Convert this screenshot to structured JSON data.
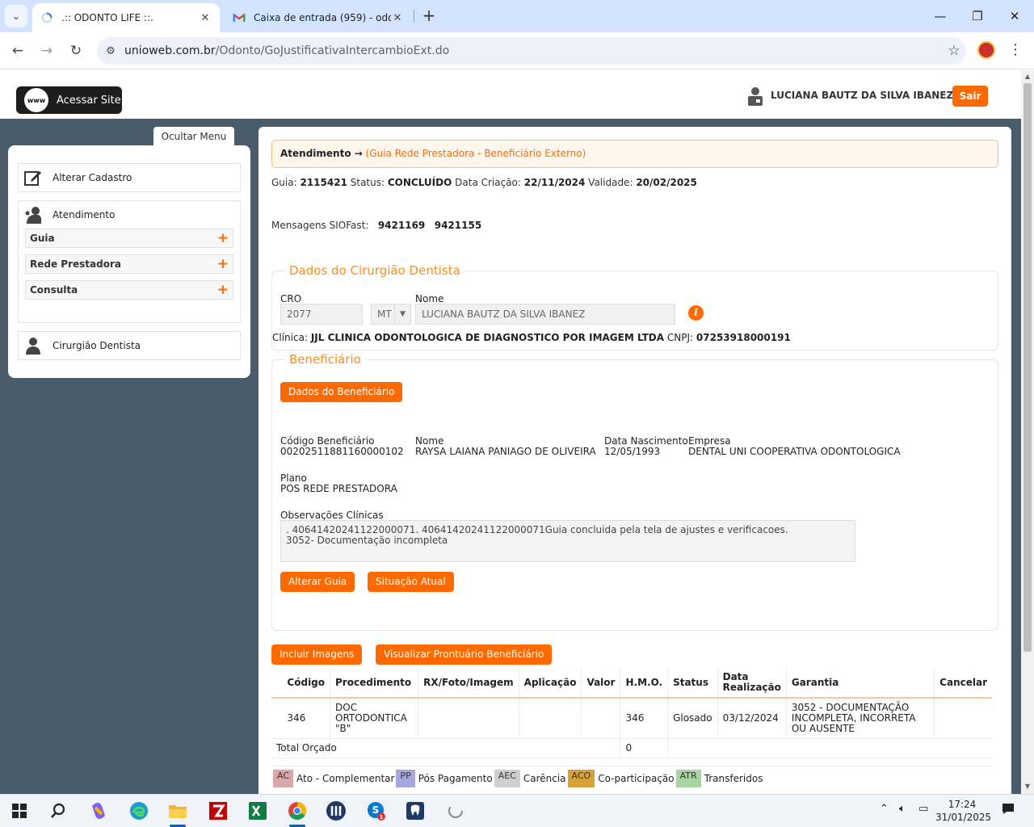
{
  "browser": {
    "tabs": [
      {
        "title": ".:: ODONTO LIFE ::.",
        "active": true
      },
      {
        "title": "Caixa de entrada (959) - odonto",
        "active": false
      }
    ],
    "url_host": "unioweb.com.br",
    "url_path": "/Odonto/GoJustificativaIntercambioExt.do"
  },
  "header": {
    "site_button": "Acessar Site",
    "www_badge": "www",
    "user_name": "LUCIANA BAUTZ DA SILVA IBANEZ",
    "logout": "Sair"
  },
  "sidebar": {
    "hide_menu": "Ocultar Menu",
    "alterar_cadastro": "Alterar Cadastro",
    "atendimento": "Atendimento",
    "subitems": [
      "Guia",
      "Rede Prestadora",
      "Consulta"
    ],
    "cirurgiao": "Cirurgião Dentista"
  },
  "main": {
    "crumb_main": "Atendimento →",
    "crumb_sub": "(Guia Rede Prestadora - Beneficiário Externo)",
    "guia_label": "Guia:",
    "guia": "2115421",
    "status_label": "Status:",
    "status": "CONCLUÍDO",
    "criacao_label": "Data Criação:",
    "criacao": "22/11/2024",
    "validade_label": "Validade:",
    "validade": "20/02/2025",
    "siofast_label": "Mensagens SIOFast:",
    "siofast_1": "9421169",
    "siofast_2": "9421155"
  },
  "dentista": {
    "legend": "Dados do Cirurgião Dentista",
    "cro_label": "CRO",
    "cro": "2077",
    "uf": "MT",
    "nome_label": "Nome",
    "nome": "LUCIANA BAUTZ DA SILVA IBANEZ",
    "clinica_label": "Clínica:",
    "clinica": "JJL CLINICA ODONTOLOGICA DE DIAGNOSTICO POR IMAGEM LTDA",
    "cnpj_label": "CNPJ:",
    "cnpj": "07253918000191"
  },
  "beneficiario": {
    "legend": "Beneficiário",
    "dados_button": "Dados do Beneficiário",
    "codigo_label": "Código Beneficiário",
    "codigo": "00202511881160000102",
    "nome_label": "Nome",
    "nome": "RAYSA LAIANA PANIAGO DE OLIVEIRA",
    "nascimento_label": "Data Nascimento",
    "nascimento": "12/05/1993",
    "empresa_label": "Empresa",
    "empresa": "DENTAL UNI COOPERATIVA ODONTOLOGICA",
    "plano_label": "Plano",
    "plano": "POS REDE PRESTADORA",
    "obs_label": "Observações Clínicas",
    "obs_line1": ". 40641420241122000071. 40641420241122000071Guia concluida pela tela de ajustes e verificacoes.",
    "obs_line2": "3052- Documentação incompleta",
    "alterar_button": "Alterar Guia",
    "situacao_button": "Situação Atual"
  },
  "actions": {
    "incluir": "Incluir Imagens",
    "prontuario": "Visualizar Prontuário Beneficiário"
  },
  "table": {
    "headers": [
      "Código",
      "Procedimento",
      "RX/Foto/Imagem",
      "Aplicação",
      "Valor",
      "H.M.O.",
      "Status",
      "Data Realização",
      "Garantia",
      "Cancelar"
    ],
    "rows": [
      {
        "codigo": "346",
        "procedimento": "DOC ORTODONTICA \"B\"",
        "rx": "",
        "aplicacao": "",
        "valor": "",
        "hmo": "346",
        "status": "Glosado",
        "data": "03/12/2024",
        "garantia": "3052 - DOCUMENTAÇÃO INCOMPLETA, INCORRETA OU AUSENTE",
        "cancelar": ""
      }
    ],
    "total_label": "Total Orçado",
    "total_value": "0"
  },
  "legend": [
    {
      "code": "AC",
      "label": "Ato - Complementar",
      "color": "#d9a7a7"
    },
    {
      "code": "PP",
      "label": "Pós Pagamento",
      "color": "#a7a7e0"
    },
    {
      "code": "AEC",
      "label": "Carência",
      "color": "#cfcfcf"
    },
    {
      "code": "ACO",
      "label": "Co-participação",
      "color": "#d8a23a"
    },
    {
      "code": "ATR",
      "label": "Transferidos",
      "color": "#a9d6a0"
    }
  ],
  "taskbar": {
    "time": "17:24",
    "date": "31/01/2025"
  },
  "colors": {
    "accent": "#ff6a00",
    "page_bg": "#4a5b6a",
    "chrome": "#d3e3fd"
  }
}
